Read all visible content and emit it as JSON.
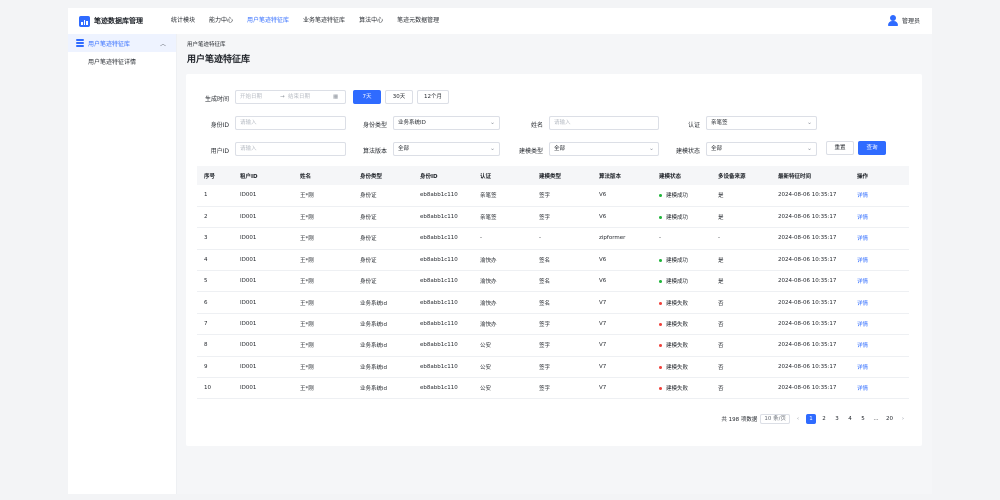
{
  "brand": {
    "title": "笔迹数据库管理"
  },
  "nav": [
    {
      "label": "统计模块",
      "active": false
    },
    {
      "label": "能力中心",
      "active": false
    },
    {
      "label": "用户笔迹特征库",
      "active": true
    },
    {
      "label": "业务笔迹特征库",
      "active": false
    },
    {
      "label": "算法中心",
      "active": false
    },
    {
      "label": "笔迹元数据管理",
      "active": false
    }
  ],
  "user": {
    "name": "管理员",
    "icon": "user-icon"
  },
  "sidebar": {
    "group_label": "用户笔迹特征库",
    "group_caret": "︿",
    "items": [
      {
        "label": "用户笔迹特征详情"
      }
    ]
  },
  "breadcrumb": "用户笔迹特征库",
  "page_title": "用户笔迹特征库",
  "filters": {
    "time_label": "生成时间",
    "start_placeholder": "开始日期",
    "sep": "→",
    "end_placeholder": "结束日期",
    "ranges": [
      "7天",
      "30天",
      "12个月"
    ],
    "id_label": "身份ID",
    "id_placeholder": "请输入",
    "idtype_label": "身份类型",
    "idtype_value": "业务系统ID",
    "name_label": "姓名",
    "name_placeholder": "请输入",
    "auth_label": "认证",
    "auth_value": "亲笔签",
    "userid_label": "用户ID",
    "userid_placeholder": "请输入",
    "algo_label": "算法版本",
    "algo_value": "全部",
    "modeltype_label": "建模类型",
    "modeltype_value": "全部",
    "modelstatus_label": "建模状态",
    "modelstatus_value": "全部",
    "reset_label": "重置",
    "query_label": "查询"
  },
  "table": {
    "headers": [
      "序号",
      "租户ID",
      "姓名",
      "身份类型",
      "身份ID",
      "认证",
      "建模类型",
      "算法版本",
      "建模状态",
      "多设备来源",
      "最新特征时间",
      "操作"
    ],
    "rows": [
      [
        "1",
        "ID001",
        "王*刚",
        "身份证",
        "eb8abb1c110",
        "亲笔签",
        "签字",
        "V6",
        "建模成功",
        "是",
        "2024-08-06 10:35:17",
        "详情"
      ],
      [
        "2",
        "ID001",
        "王*刚",
        "身份证",
        "eb8abb1c110",
        "亲笔签",
        "签字",
        "V6",
        "建模成功",
        "是",
        "2024-08-06 10:35:17",
        "详情"
      ],
      [
        "3",
        "ID001",
        "王*刚",
        "身份证",
        "eb8abb1c110",
        "-",
        "-",
        "zipformer",
        "-",
        "-",
        "2024-08-06 10:35:17",
        "详情"
      ],
      [
        "4",
        "ID001",
        "王*刚",
        "身份证",
        "eb8abb1c110",
        "渝快办",
        "签名",
        "V6",
        "建模成功",
        "是",
        "2024-08-06 10:35:17",
        "详情"
      ],
      [
        "5",
        "ID001",
        "王*刚",
        "身份证",
        "eb8abb1c110",
        "渝快办",
        "签名",
        "V6",
        "建模成功",
        "是",
        "2024-08-06 10:35:17",
        "详情"
      ],
      [
        "6",
        "ID001",
        "王*刚",
        "业务系统id",
        "eb8abb1c110",
        "渝快办",
        "签名",
        "V7",
        "建模失败",
        "否",
        "2024-08-06 10:35:17",
        "详情"
      ],
      [
        "7",
        "ID001",
        "王*刚",
        "业务系统id",
        "eb8abb1c110",
        "渝快办",
        "签字",
        "V7",
        "建模失败",
        "否",
        "2024-08-06 10:35:17",
        "详情"
      ],
      [
        "8",
        "ID001",
        "王*刚",
        "业务系统id",
        "eb8abb1c110",
        "公安",
        "签字",
        "V7",
        "建模失败",
        "否",
        "2024-08-06 10:35:17",
        "详情"
      ],
      [
        "9",
        "ID001",
        "王*刚",
        "业务系统id",
        "eb8abb1c110",
        "公安",
        "签字",
        "V7",
        "建模失败",
        "否",
        "2024-08-06 10:35:17",
        "详情"
      ],
      [
        "10",
        "ID001",
        "王*刚",
        "业务系统id",
        "eb8abb1c110",
        "公安",
        "签字",
        "V7",
        "建模失败",
        "否",
        "2024-08-06 10:35:17",
        "详情"
      ]
    ]
  },
  "status_colors": {
    "建模成功": "#1fb53a",
    "建模失败": "#f0413b"
  },
  "pagination": {
    "total_text": "共 198 项数据",
    "page_size": "10 条/页",
    "prev": "‹",
    "pages": [
      "1",
      "2",
      "3",
      "4",
      "5",
      "...",
      "20"
    ],
    "current": "1",
    "next": "›"
  }
}
